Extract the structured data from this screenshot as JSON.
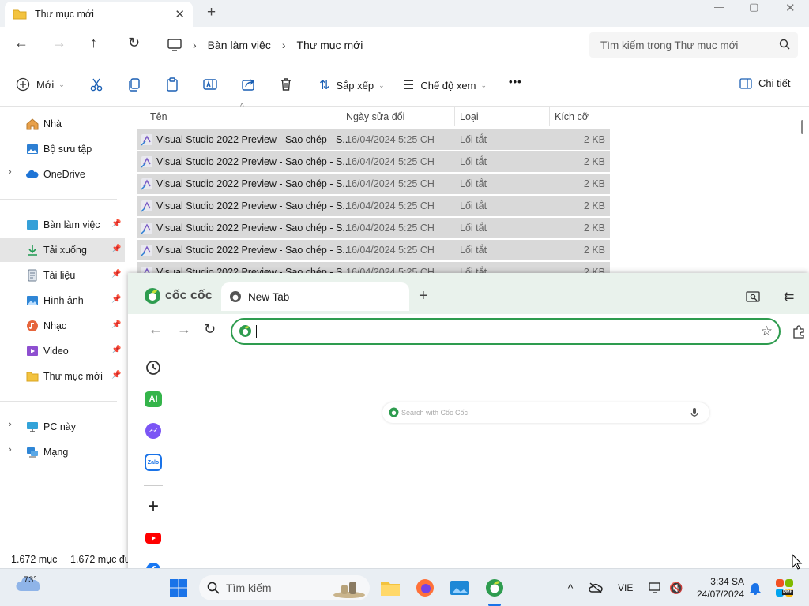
{
  "explorer": {
    "tab_title": "Thư mục mới",
    "breadcrumb": [
      "Bàn làm việc",
      "Thư mục mới"
    ],
    "search_placeholder": "Tìm kiếm trong Thư mục mới",
    "toolbar": {
      "new_label": "Mới",
      "sort_label": "Sắp xếp",
      "view_label": "Chế độ xem",
      "more_label": "•••",
      "details_label": "Chi tiết"
    },
    "sidebar": {
      "items": [
        {
          "label": "Nhà",
          "icon": "home-icon"
        },
        {
          "label": "Bộ sưu tập",
          "icon": "gallery-icon"
        },
        {
          "label": "OneDrive",
          "icon": "onedrive-icon"
        },
        {
          "label": "Bàn làm việc",
          "icon": "desktop-icon"
        },
        {
          "label": "Tải xuống",
          "icon": "download-icon"
        },
        {
          "label": "Tài liệu",
          "icon": "documents-icon"
        },
        {
          "label": "Hình ảnh",
          "icon": "pictures-icon"
        },
        {
          "label": "Nhạc",
          "icon": "music-icon"
        },
        {
          "label": "Video",
          "icon": "video-icon"
        },
        {
          "label": "Thư mục mới",
          "icon": "folder-icon"
        },
        {
          "label": "PC này",
          "icon": "pc-icon"
        },
        {
          "label": "Mạng",
          "icon": "network-icon"
        }
      ]
    },
    "columns": [
      "Tên",
      "Ngày sửa đổi",
      "Loại",
      "Kích cỡ"
    ],
    "files": [
      {
        "name": "Visual Studio 2022 Preview - Sao chép - S...",
        "date": "16/04/2024 5:25 CH",
        "type": "Lối tắt",
        "size": "2 KB"
      },
      {
        "name": "Visual Studio 2022 Preview - Sao chép - S...",
        "date": "16/04/2024 5:25 CH",
        "type": "Lối tắt",
        "size": "2 KB"
      },
      {
        "name": "Visual Studio 2022 Preview - Sao chép - S...",
        "date": "16/04/2024 5:25 CH",
        "type": "Lối tắt",
        "size": "2 KB"
      },
      {
        "name": "Visual Studio 2022 Preview - Sao chép - S...",
        "date": "16/04/2024 5:25 CH",
        "type": "Lối tắt",
        "size": "2 KB"
      },
      {
        "name": "Visual Studio 2022 Preview - Sao chép - S...",
        "date": "16/04/2024 5:25 CH",
        "type": "Lối tắt",
        "size": "2 KB"
      },
      {
        "name": "Visual Studio 2022 Preview - Sao chép - S...",
        "date": "16/04/2024 5:25 CH",
        "type": "Lối tắt",
        "size": "2 KB"
      },
      {
        "name": "Visual Studio 2022 Preview - Sao chép - S...",
        "date": "16/04/2024 5:25 CH",
        "type": "Lối tắt",
        "size": "2 KB"
      }
    ],
    "status": {
      "count": "1.672 mục",
      "selected": "1.672 mục đư"
    }
  },
  "browser": {
    "brand": "cốc cốc",
    "tab_title": "New Tab",
    "search_placeholder": "Search with Cốc Cốc",
    "sidebar_icons": [
      "history-icon",
      "ai-icon",
      "messenger-icon",
      "zalo-icon",
      "add-icon",
      "youtube-icon",
      "facebook-icon"
    ],
    "ai_label": "AI",
    "zalo_label": "Zalo"
  },
  "taskbar": {
    "weather": "73°",
    "search_label": "Tìm kiếm",
    "language": "VIE",
    "time": "3:34 SA",
    "date": "24/07/2024",
    "pre_badge": "PRE"
  },
  "colors": {
    "coccoc_green": "#2e9c4f",
    "selection_gray": "#d9d9d9",
    "folder_yellow": "#f3c33f"
  }
}
